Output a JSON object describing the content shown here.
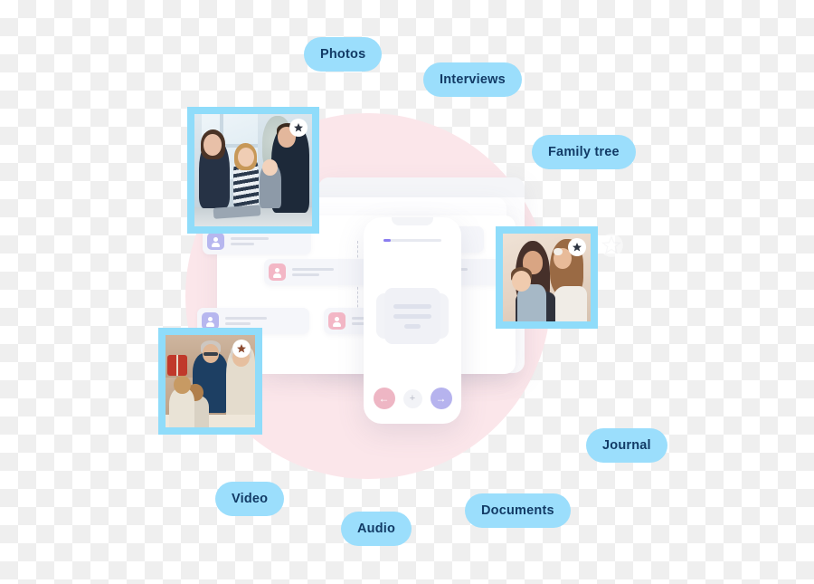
{
  "scene": {
    "title": "Family memories collage",
    "background_style": "transparency-checkerboard",
    "backdrop_circle_color": "#fbe6ea",
    "frame_border_color": "#8fdcfa",
    "pill_background_color": "#9bdefc",
    "pill_text_color": "#123b66"
  },
  "pills": [
    {
      "id": "photos",
      "label": "Photos"
    },
    {
      "id": "interviews",
      "label": "Interviews"
    },
    {
      "id": "family",
      "label": "Family tree"
    },
    {
      "id": "journal",
      "label": "Journal"
    },
    {
      "id": "video",
      "label": "Video"
    },
    {
      "id": "audio",
      "label": "Audio"
    },
    {
      "id": "documents",
      "label": "Documents"
    }
  ],
  "photos": [
    {
      "id": "photo-1",
      "alt": "Family with two children reading together on the floor by a window",
      "badge_icon": "star-icon"
    },
    {
      "id": "photo-2",
      "alt": "Mother kissing a baby while a young girl leans on her shoulder",
      "badge_icon": "star-icon"
    },
    {
      "id": "photo-3",
      "alt": "Grandfather and family gathered around a dinner table",
      "badge_icon": "star-icon"
    }
  ],
  "phone": {
    "notch": "phone-notch",
    "progress_fill_color": "#8b7ef0",
    "actions": [
      {
        "id": "prev",
        "icon": "arrow-left-icon",
        "glyph": "←",
        "color": "#eeb6c4"
      },
      {
        "id": "add",
        "icon": "plus-icon",
        "glyph": "+",
        "color": "#f2f3f7"
      },
      {
        "id": "next",
        "icon": "arrow-right-icon",
        "glyph": "→",
        "color": "#b6b3ee"
      }
    ]
  },
  "family_tree": {
    "avatar_colors": {
      "pink": "#f3b7c6",
      "purple": "#b7b7ef"
    },
    "nodes": [
      {
        "id": "n1",
        "avatar": "purple",
        "row": "top"
      },
      {
        "id": "n2",
        "avatar": "pink",
        "row": "top"
      },
      {
        "id": "n3",
        "avatar": "pink",
        "row": "middle"
      },
      {
        "id": "n4",
        "avatar": "purple",
        "row": "middle"
      },
      {
        "id": "n5",
        "avatar": "purple",
        "row": "bottom"
      },
      {
        "id": "n6",
        "avatar": "pink",
        "row": "bottom"
      }
    ]
  }
}
